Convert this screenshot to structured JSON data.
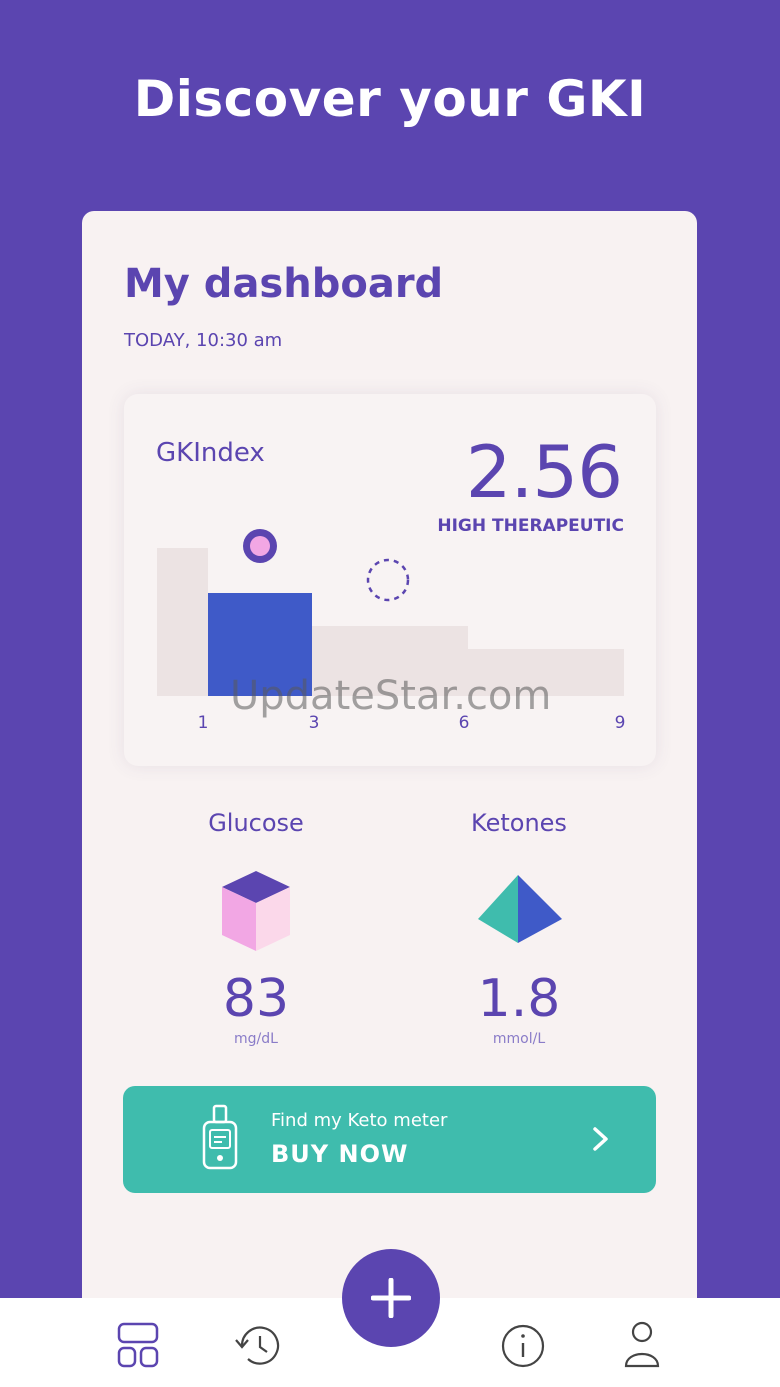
{
  "hero": {
    "title": "Discover your GKI"
  },
  "dashboard": {
    "title": "My dashboard",
    "date": "TODAY, 10:30 am"
  },
  "gki": {
    "label": "GKIndex",
    "value": "2.56",
    "status": "HIGH THERAPEUTIC",
    "chart_data": {
      "type": "bar",
      "x_ticks": [
        "1",
        "3",
        "6",
        "9"
      ],
      "current_value": 2.56
    }
  },
  "watermark": "UpdateStar.com",
  "metrics": {
    "glucose": {
      "label": "Glucose",
      "value": "83",
      "unit": "mg/dL",
      "icon": "cube-icon"
    },
    "ketones": {
      "label": "Ketones",
      "value": "1.8",
      "unit": "mmol/L",
      "icon": "pyramid-icon"
    }
  },
  "buy": {
    "subtitle": "Find my Keto meter",
    "label": "BUY NOW",
    "icon": "keto-meter-icon"
  },
  "nav": {
    "items": [
      "dashboard-icon",
      "history-icon",
      "add-icon",
      "info-icon",
      "profile-icon"
    ]
  },
  "colors": {
    "brand": "#5b45b0",
    "teal": "#3fbcad",
    "blue_bar": "#3f5ac8",
    "pink": "#f2a7e4"
  }
}
